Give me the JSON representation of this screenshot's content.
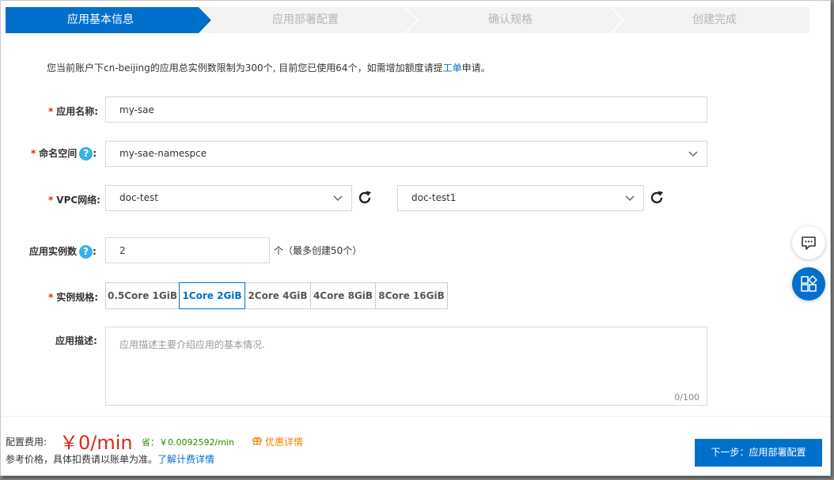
{
  "steps": [
    {
      "label": "应用基本信息",
      "active": true
    },
    {
      "label": "应用部署配置",
      "active": false
    },
    {
      "label": "确认规格",
      "active": false
    },
    {
      "label": "创建完成",
      "active": false
    }
  ],
  "notice": {
    "text": "您当前账户下cn-beijing的应用总实例数限制为300个, 目前您已使用64个，如需增加额度请提",
    "link": "工单",
    "suffix": "申请。"
  },
  "form": {
    "required_mark": "*",
    "help_glyph": "?",
    "app_name": {
      "label": "应用名称:",
      "value": "my-sae"
    },
    "namespace": {
      "label": "命名空间",
      "colon": ":",
      "value": "my-sae-namespce"
    },
    "vpc": {
      "label": "VPC网络:",
      "vpc_value": "doc-test",
      "vswitch_value": "doc-test1"
    },
    "instances": {
      "label": "应用实例数",
      "colon": ":",
      "value": "2",
      "hint": "个（最多创建50个）"
    },
    "spec": {
      "label": "实例规格:",
      "options": [
        "0.5Core 1GiB",
        "1Core 2GiB",
        "2Core 4GiB",
        "4Core 8GiB",
        "8Core 16GiB"
      ],
      "selected": "1Core 2GiB"
    },
    "description": {
      "label": "应用描述:",
      "placeholder": "应用描述主要介绍应用的基本情况.",
      "counter": "0/100"
    }
  },
  "footer": {
    "fee_label": "配置费用:",
    "fee_value": "￥0/min",
    "save_text": "省：￥0.0092592/min",
    "discount_text": "优惠详情",
    "ref_text": "参考价格，具体扣费请以账单为准。",
    "ref_link": "了解计费详情",
    "next_button": "下一步：应用部署配置"
  },
  "colors": {
    "primary": "#0070cc",
    "required": "#e0251b",
    "save": "#2e8b00",
    "discount": "#f08200",
    "help": "#38b2e6"
  },
  "icons": [
    "chevron-down-icon",
    "refresh-icon",
    "help-icon",
    "chat-icon",
    "apps-icon",
    "gift-icon"
  ]
}
